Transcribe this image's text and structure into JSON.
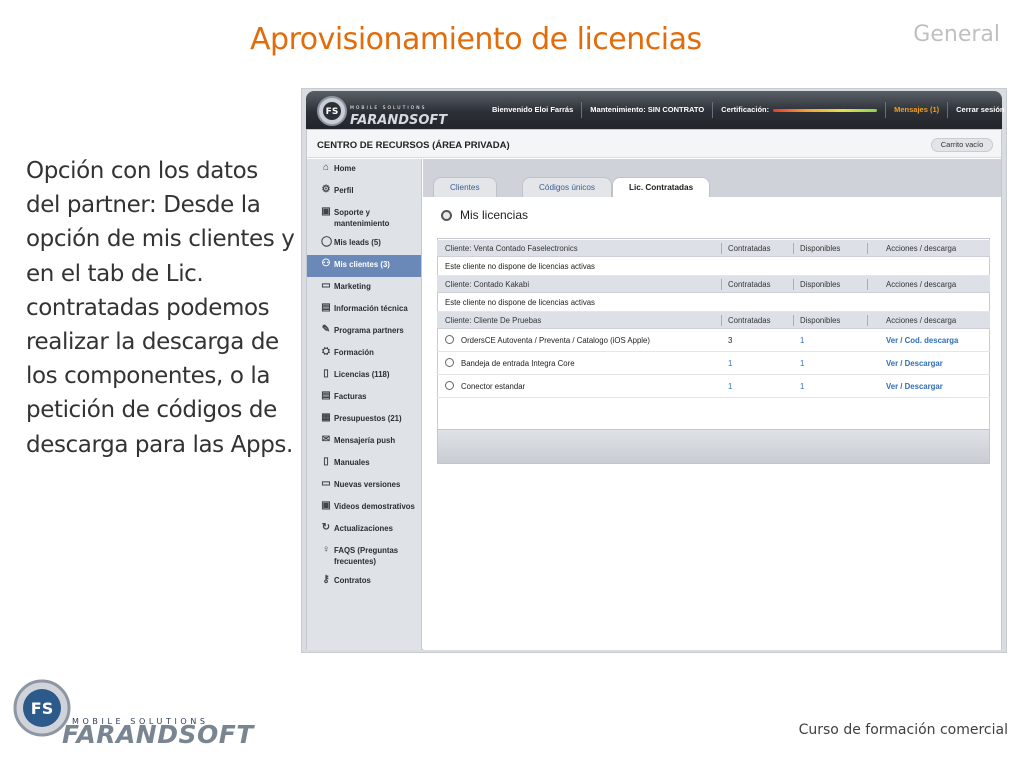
{
  "slide": {
    "title": "Aprovisionamiento de licencias",
    "section": "General",
    "description": "Opción con los datos del partner: Desde la opción de mis clientes y en el tab de Lic. contratadas podemos realizar la descarga de los componentes, o la petición de códigos de descarga para las Apps.",
    "footer": "Curso de formación comercial",
    "logo": {
      "tagline": "MOBILE SOLUTIONS",
      "brand": "FARANDSOFT",
      "badge": "FS"
    }
  },
  "app": {
    "topbar": {
      "logo_badge": "FS",
      "logo_tagline": "MOBILE SOLUTIONS",
      "logo_brand": "FARANDSOFT",
      "welcome": "Bienvenido Eloi Farrás",
      "maintenance": "Mantenimiento: SIN CONTRATO",
      "certification": "Certificación:",
      "messages": "Mensajes (1)",
      "logout": "Cerrar sesión"
    },
    "breadcrumb": "CENTRO DE RECURSOS (ÁREA PRIVADA)",
    "cart": "Carrito vacío",
    "sidebar": [
      {
        "label": "Home",
        "icon": "home-icon",
        "glyph": "⌂"
      },
      {
        "label": "Perfil",
        "icon": "gear-icon",
        "glyph": "⚙"
      },
      {
        "label": "Soporte y mantenimiento",
        "icon": "support-icon",
        "glyph": "▣"
      },
      {
        "label": "Mis leads (5)",
        "icon": "chat-icon",
        "glyph": "◯"
      },
      {
        "label": "Mis clientes (3)",
        "icon": "users-icon",
        "glyph": "⚇"
      },
      {
        "label": "Marketing",
        "icon": "briefcase-icon",
        "glyph": "▭"
      },
      {
        "label": "Información técnica",
        "icon": "chart-icon",
        "glyph": "▤"
      },
      {
        "label": "Programa partners",
        "icon": "pencil-icon",
        "glyph": "✎"
      },
      {
        "label": "Formación",
        "icon": "cap-icon",
        "glyph": "⛭"
      },
      {
        "label": "Licencias (118)",
        "icon": "device-icon",
        "glyph": "▯"
      },
      {
        "label": "Facturas",
        "icon": "invoice-icon",
        "glyph": "▤"
      },
      {
        "label": "Presupuestos (21)",
        "icon": "budget-icon",
        "glyph": "▦"
      },
      {
        "label": "Mensajería push",
        "icon": "mail-icon",
        "glyph": "✉"
      },
      {
        "label": "Manuales",
        "icon": "document-icon",
        "glyph": "▯"
      },
      {
        "label": "Nuevas versiones",
        "icon": "folder-icon",
        "glyph": "▭"
      },
      {
        "label": "Videos demostrativos",
        "icon": "video-icon",
        "glyph": "▣"
      },
      {
        "label": "Actualizaciones",
        "icon": "refresh-icon",
        "glyph": "↻"
      },
      {
        "label": "FAQS (Preguntas frecuentes)",
        "icon": "bulb-icon",
        "glyph": "♀"
      },
      {
        "label": "Contratos",
        "icon": "key-icon",
        "glyph": "⚷"
      }
    ],
    "tabs": [
      {
        "label": "Clientes"
      },
      {
        "label": "Códigos únicos"
      },
      {
        "label": "Lic. Contratadas"
      }
    ],
    "section_title": "Mis licencias",
    "table": {
      "col_contracted": "Contratadas",
      "col_available": "Disponibles",
      "col_actions": "Acciones / descarga",
      "clients": [
        {
          "name": "Cliente: Venta Contado Faselectronics",
          "empty": "Este cliente no dispone de licencias activas"
        },
        {
          "name": "Cliente: Contado Kakabi",
          "empty": "Este cliente no dispone de licencias activas"
        },
        {
          "name": "Cliente: Cliente De Pruebas",
          "products": [
            {
              "name": "OrdersCE Autoventa / Preventa / Catalogo (iOS Apple)",
              "contracted": "3",
              "available": "1",
              "view": "Ver",
              "action": "Cod. descarga"
            },
            {
              "name": "Bandeja de entrada Integra Core",
              "contracted": "1",
              "available": "1",
              "view": "Ver",
              "action": "Descargar"
            },
            {
              "name": "Conector estandar",
              "contracted": "1",
              "available": "1",
              "view": "Ver",
              "action": "Descargar"
            }
          ]
        }
      ]
    },
    "colors": {
      "accent": "#e36c0a",
      "active_nav": "#6a88b8",
      "link": "#2f6fb8",
      "topbar": "#2c3036"
    }
  }
}
